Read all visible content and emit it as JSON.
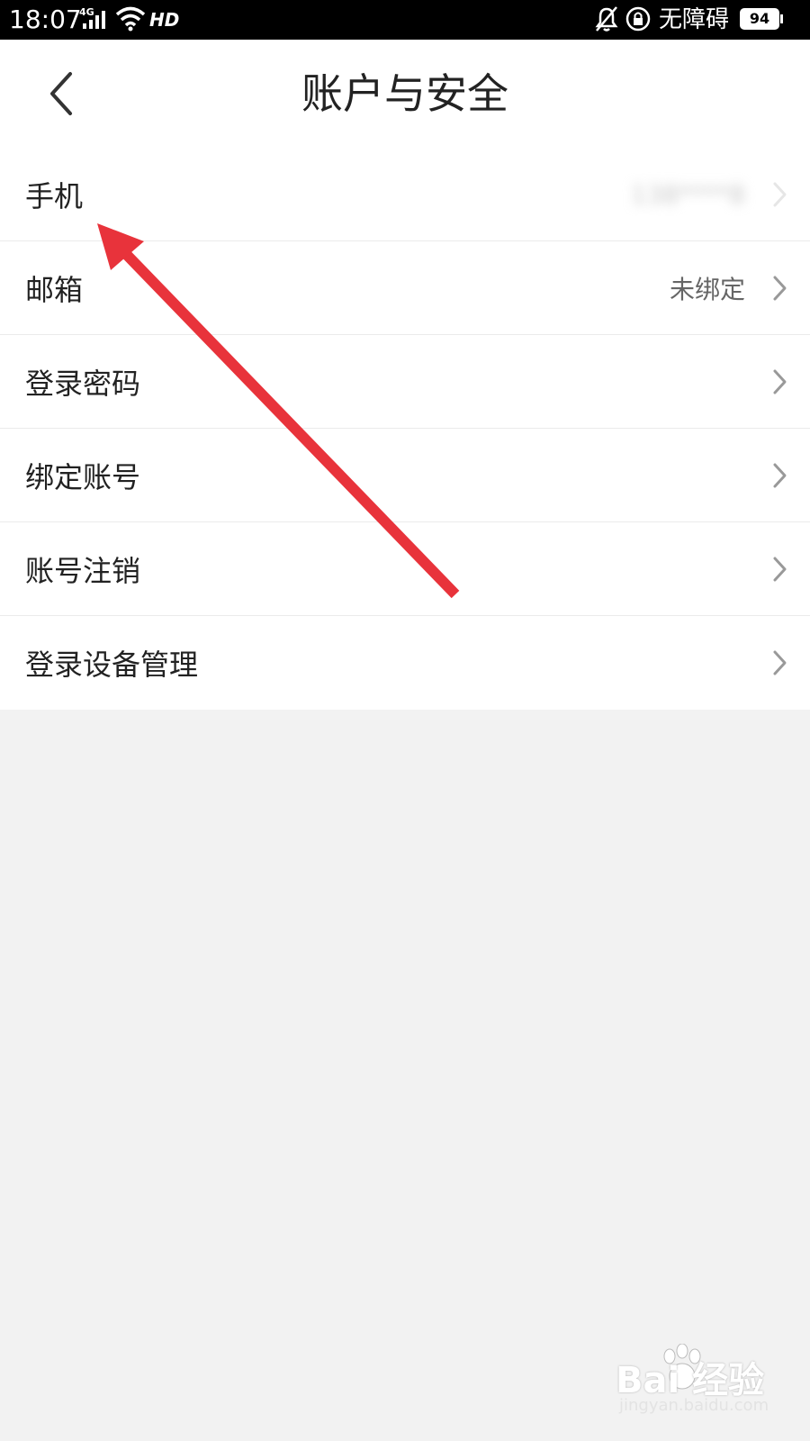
{
  "status_bar": {
    "time": "18:07",
    "network": "4G",
    "hd": "HD",
    "accessibility": "无障碍",
    "battery": "94"
  },
  "header": {
    "back_icon": "chevron-left-icon",
    "title": "账户与安全"
  },
  "settings": {
    "items": [
      {
        "label": "手机",
        "value": "138****8"
      },
      {
        "label": "邮箱",
        "value": "未绑定"
      },
      {
        "label": "登录密码"
      },
      {
        "label": "绑定账号"
      },
      {
        "label": "账号注销"
      },
      {
        "label": "登录设备管理"
      }
    ]
  },
  "annotation": {
    "color": "#e8333b",
    "icon": "red-arrow"
  },
  "watermark": {
    "brand": "Bai  经验",
    "site": "jingyan.baidu.com"
  }
}
